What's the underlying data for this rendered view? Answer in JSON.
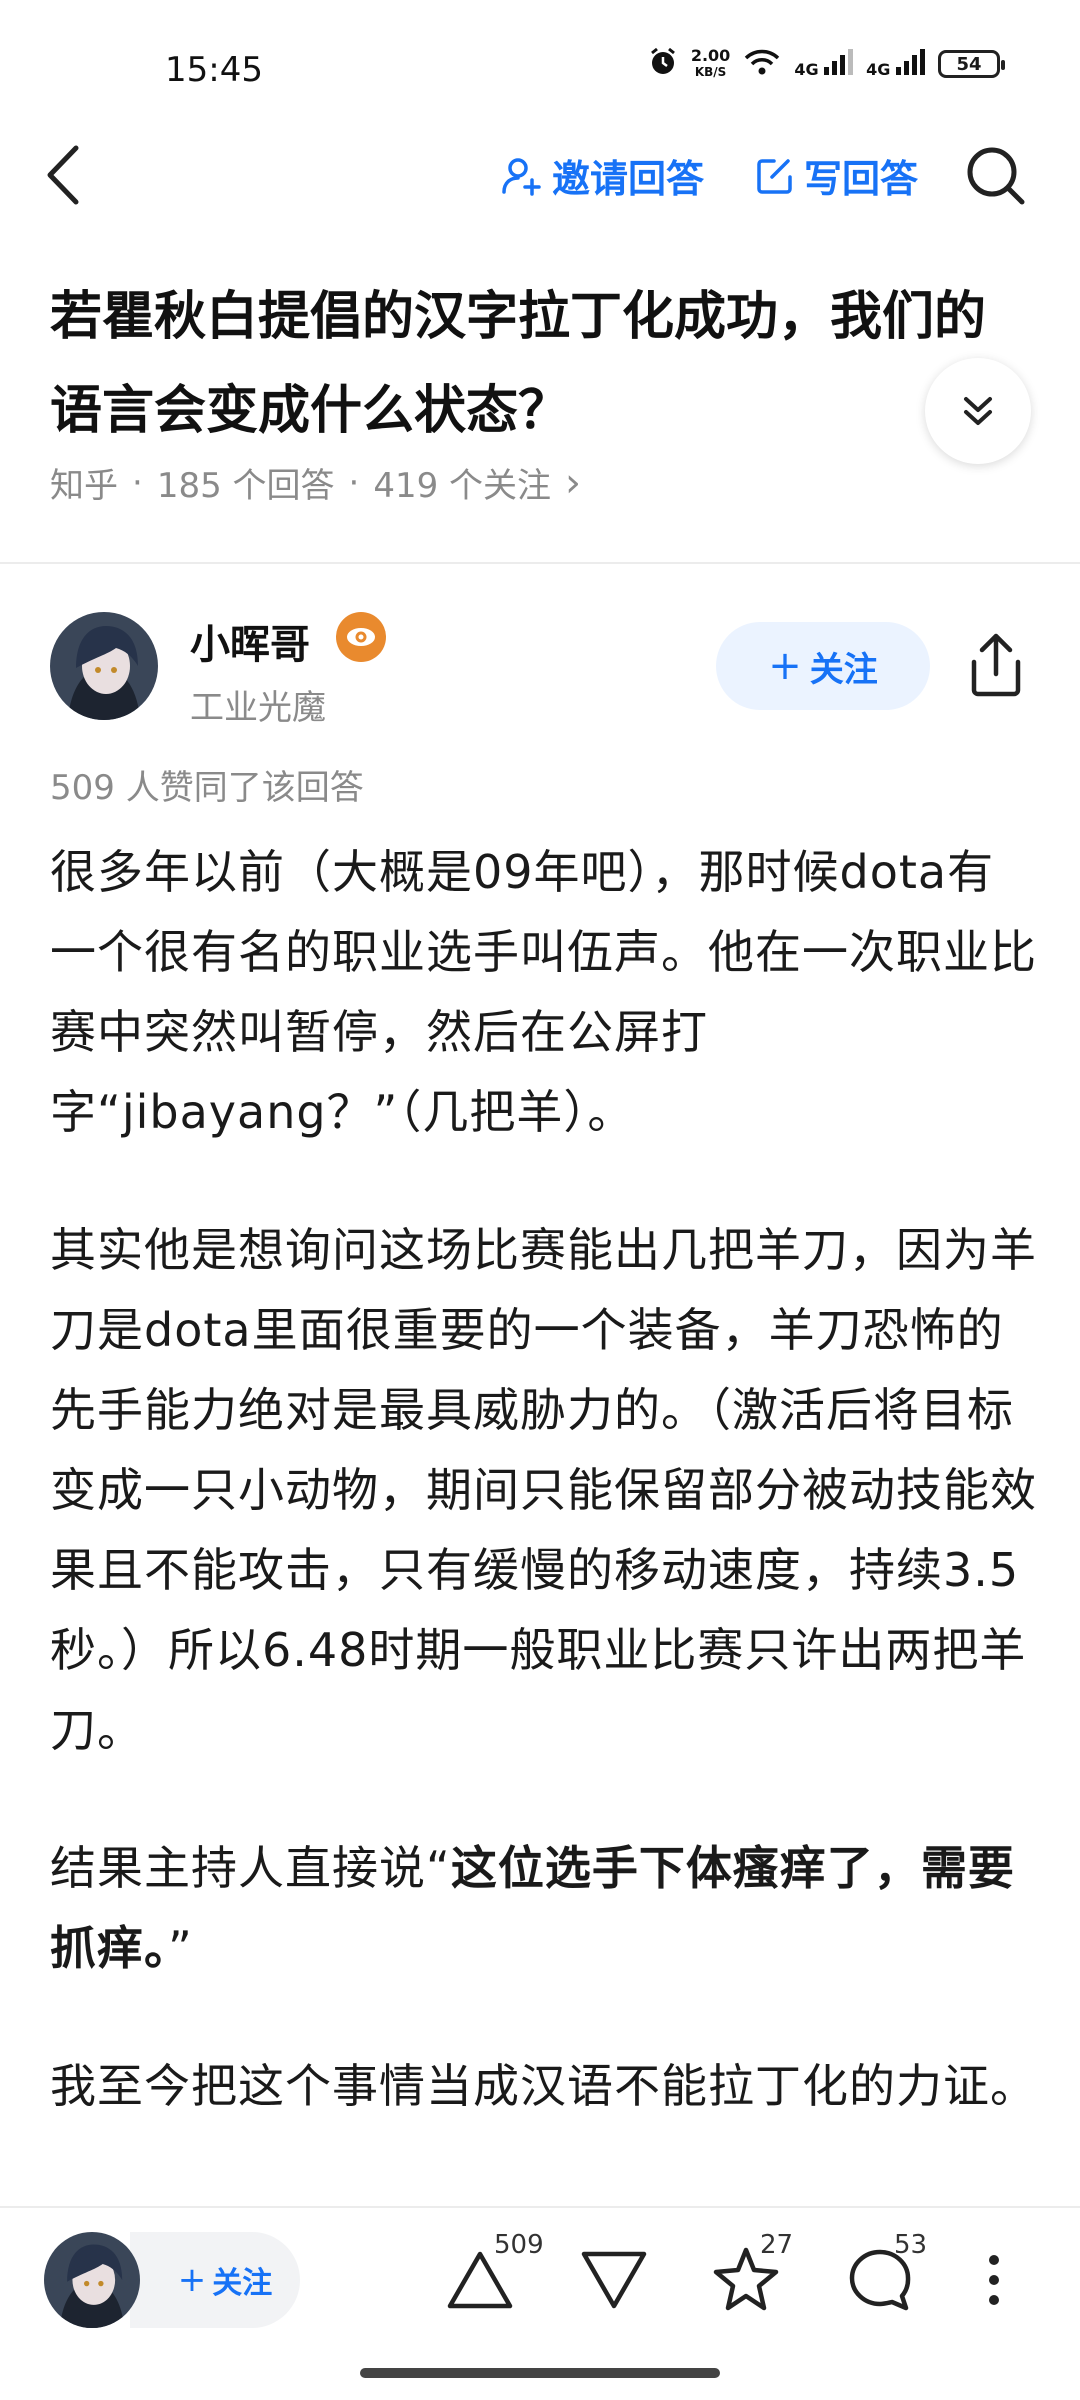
{
  "status_bar": {
    "time": "15:45",
    "net_speed_value": "2.00",
    "net_speed_unit": "KB/S",
    "signal1": "4G",
    "signal2": "4G",
    "battery": "54"
  },
  "nav": {
    "invite_label": "邀请回答",
    "write_label": "写回答"
  },
  "question": {
    "title": "若瞿秋白提倡的汉字拉丁化成功，我们的语言会变成什么状态？",
    "source": "知乎",
    "answers_count": "185 个回答",
    "followers_count": "419 个关注",
    "sep": "·",
    "chevron": "›"
  },
  "author": {
    "name": "小晖哥",
    "bio": "工业光魔",
    "follow_label": "关注",
    "likes_text": "509 人赞同了该回答"
  },
  "answer": {
    "p1": "很多年以前（大概是09年吧），那时候dota有一个很有名的职业选手叫伍声。他在一次职业比赛中突然叫暂停，然后在公屏打字“jibayang？”（几把羊）。",
    "p2": "其实他是想询问这场比赛能出几把羊刀，因为羊刀是dota里面很重要的一个装备，羊刀恐怖的先手能力绝对是最具威胁力的。（激活后将目标变成一只小动物，期间只能保留部分被动技能效果且不能攻击，只有缓慢的移动速度，持续3.5秒。）所以6.48时期一般职业比赛只许出两把羊刀。",
    "p3_prefix": "结果主持人直接说“",
    "p3_bold": "这位选手下体瘙痒了，需要抓痒。",
    "p3_suffix": "”",
    "p4": "我至今把这个事情当成汉语不能拉丁化的力证。"
  },
  "bottom_bar": {
    "follow_label": "关注",
    "upvote_count": "509",
    "favorite_count": "27",
    "comment_count": "53"
  },
  "colors": {
    "accent": "#1772f6",
    "follow_bg": "#ebf3ff",
    "meta_gray": "#8a8a8a"
  }
}
